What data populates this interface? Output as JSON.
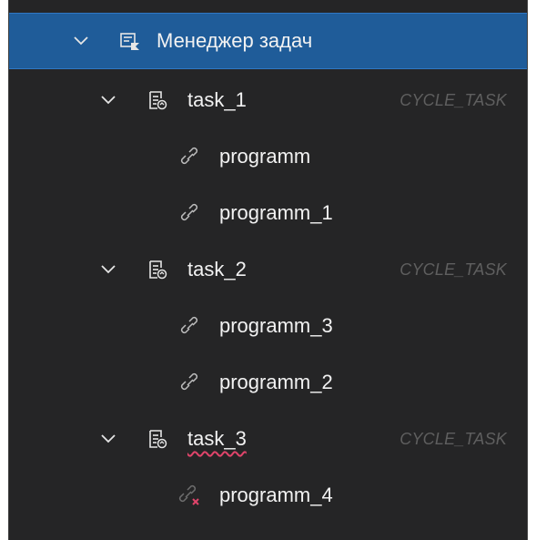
{
  "tree": {
    "root": {
      "label": "Менеджер задач",
      "icon": "task-manager-icon",
      "expanded": true,
      "selected": true
    },
    "tasks": [
      {
        "label": "task_1",
        "type": "CYCLE_TASK",
        "icon": "task-list-icon",
        "expanded": true,
        "error_underline": false,
        "children": [
          {
            "label": "programm",
            "icon": "link-icon",
            "broken": false
          },
          {
            "label": "programm_1",
            "icon": "link-icon",
            "broken": false
          }
        ]
      },
      {
        "label": "task_2",
        "type": "CYCLE_TASK",
        "icon": "task-list-icon",
        "expanded": true,
        "error_underline": false,
        "children": [
          {
            "label": "programm_3",
            "icon": "link-icon",
            "broken": false
          },
          {
            "label": "programm_2",
            "icon": "link-icon",
            "broken": false
          }
        ]
      },
      {
        "label": "task_3",
        "type": "CYCLE_TASK",
        "icon": "task-list-icon",
        "expanded": true,
        "error_underline": true,
        "children": [
          {
            "label": "programm_4",
            "icon": "broken-link-icon",
            "broken": true
          }
        ]
      }
    ]
  },
  "colors": {
    "panel_bg": "#252526",
    "selection_bg": "#1f5c99",
    "text": "#f2f2f2",
    "type_tag": "#5f5f5f",
    "error_underline": "#e0446a",
    "broken_link": "#e0446a"
  }
}
